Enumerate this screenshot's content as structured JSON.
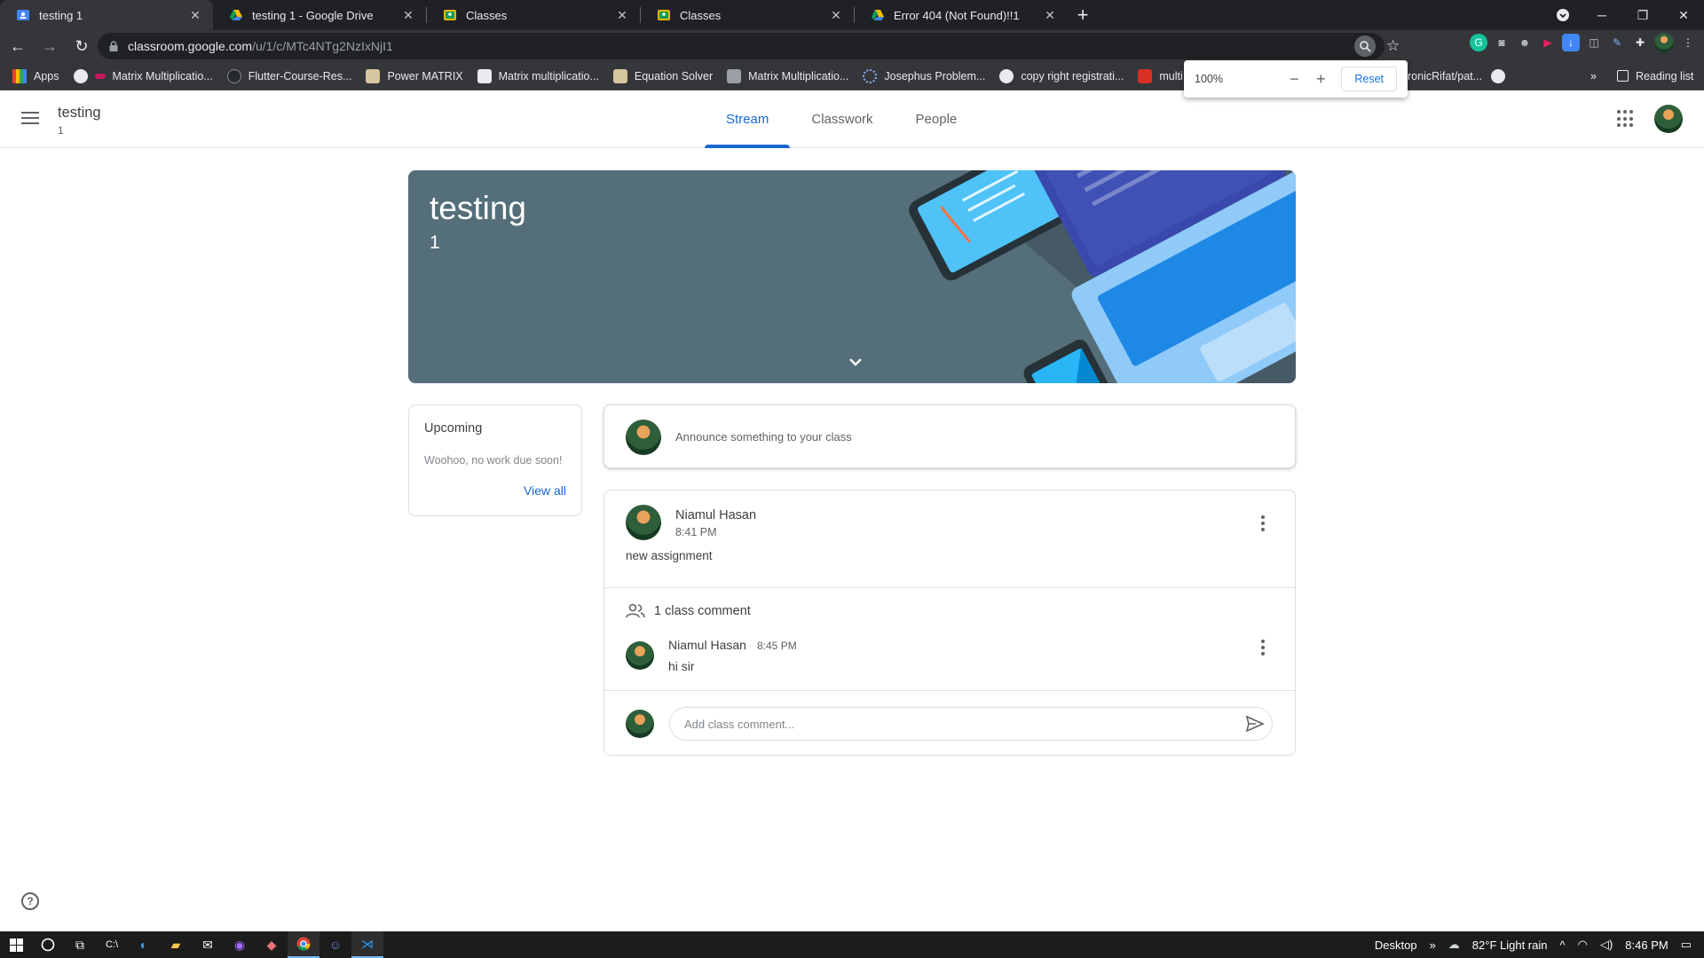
{
  "browser": {
    "tabs": [
      {
        "title": "testing 1",
        "icon": "classroom-icon",
        "active": true
      },
      {
        "title": "testing 1 - Google Drive",
        "icon": "drive-icon"
      },
      {
        "title": "Classes",
        "icon": "classroom-icon"
      },
      {
        "title": "Classes",
        "icon": "classroom-icon"
      },
      {
        "title": "Error 404 (Not Found)!!1",
        "icon": "drive-icon"
      }
    ],
    "url_host": "classroom.google.com",
    "url_path": "/u/1/c/MTc4NTg2NzIxNjI1",
    "bookmarks": [
      "Apps",
      "Matrix Multiplicatio...",
      "Flutter-Course-Res...",
      "Power MATRIX",
      "Matrix multiplicatio...",
      "Equation Solver",
      "Matrix Multiplicatio...",
      "Josephus Problem...",
      "copy right registrati...",
      "multi thre",
      "ronicRifat/pat..."
    ],
    "reading_list": "Reading list",
    "zoom": {
      "value": "100%",
      "reset_label": "Reset"
    }
  },
  "classroom": {
    "class_title": "testing",
    "class_section": "1",
    "tabs": [
      "Stream",
      "Classwork",
      "People"
    ],
    "active_tab": "Stream",
    "banner": {
      "title": "testing",
      "section": "1"
    },
    "upcoming": {
      "heading": "Upcoming",
      "text": "Woohoo, no work due soon!",
      "view_all": "View all"
    },
    "announce_placeholder": "Announce something to your class",
    "post": {
      "author": "Niamul Hasan",
      "time": "8:41 PM",
      "body": "new assignment",
      "comment_count": "1 class comment",
      "comment": {
        "author": "Niamul Hasan",
        "time": "8:45 PM",
        "text": "hi sir"
      },
      "comment_placeholder": "Add class comment..."
    }
  },
  "taskbar": {
    "desktop": "Desktop",
    "weather": "82°F  Light rain",
    "time": "8:46 PM"
  },
  "colors": {
    "accent": "#1967d2",
    "banner": "#546e7a",
    "chrome_dark": "#202124"
  }
}
